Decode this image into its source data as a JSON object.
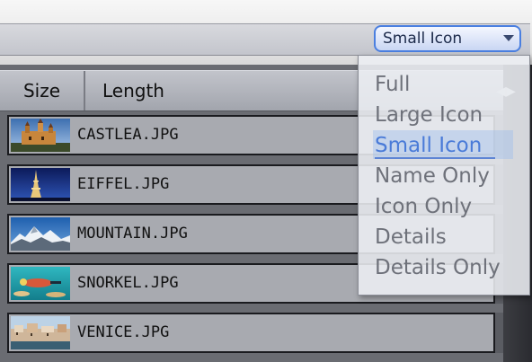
{
  "view_select": {
    "value": "Small Icon",
    "icon": "chevron-down-icon"
  },
  "columns": [
    {
      "label": "Size"
    },
    {
      "label": "Length"
    }
  ],
  "files": [
    {
      "name": "CASTLEA.JPG",
      "thumb": "castle"
    },
    {
      "name": "EIFFEL.JPG",
      "thumb": "eiffel"
    },
    {
      "name": "MOUNTAIN.JPG",
      "thumb": "mountain"
    },
    {
      "name": "SNORKEL.JPG",
      "thumb": "snorkel"
    },
    {
      "name": "VENICE.JPG",
      "thumb": "venice"
    }
  ],
  "dropdown": {
    "selected_index": 2,
    "options": [
      {
        "label": "Full"
      },
      {
        "label": "Large Icon"
      },
      {
        "label": "Small Icon"
      },
      {
        "label": "Name Only"
      },
      {
        "label": "Icon Only"
      },
      {
        "label": "Details"
      },
      {
        "label": "Details Only"
      }
    ]
  },
  "colors": {
    "select_border": "#4a7fe0",
    "selected_option": "#4a7bd8",
    "row_background": "#a8aab0"
  }
}
